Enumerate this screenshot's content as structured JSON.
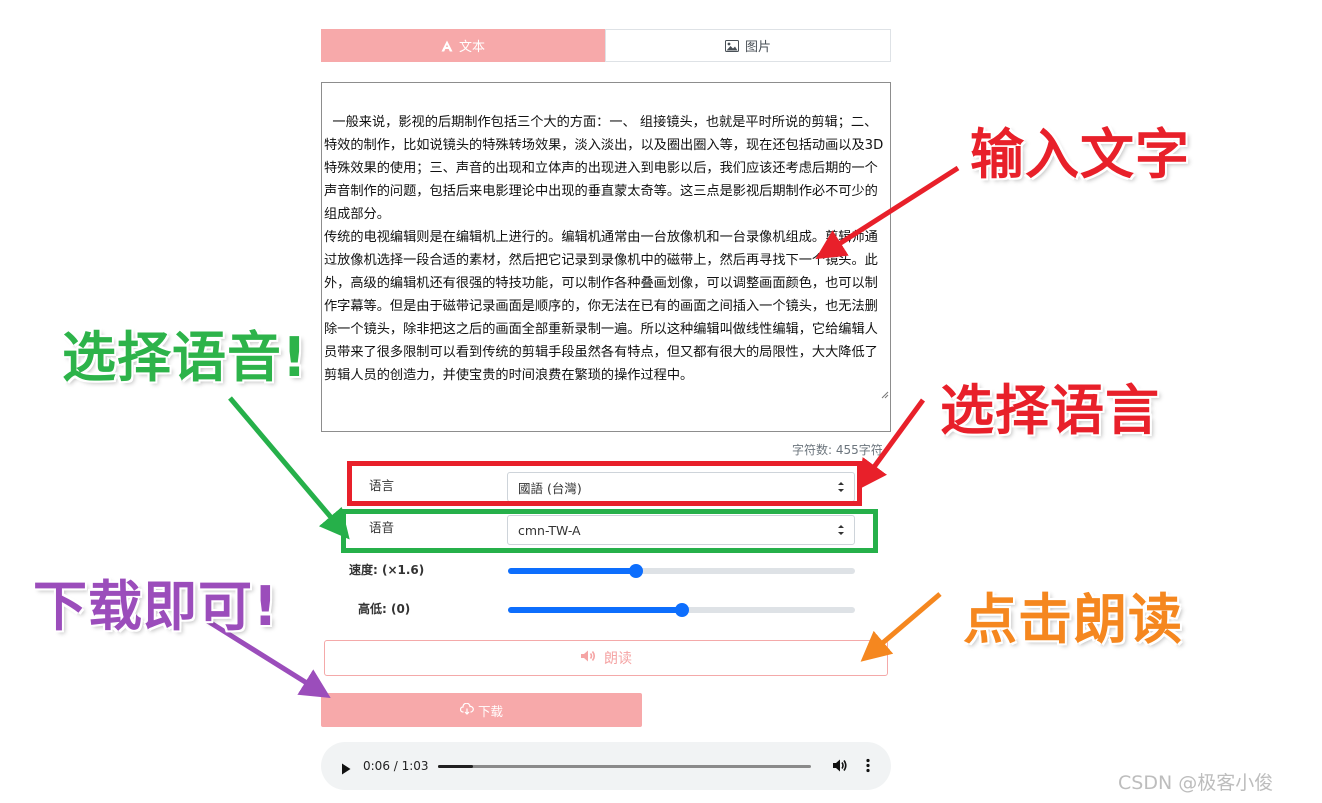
{
  "tabs": [
    {
      "label": "文本",
      "icon": "font-icon",
      "active": true
    },
    {
      "label": "图片",
      "icon": "image-icon",
      "active": false
    }
  ],
  "text_input": {
    "value": "一般来说，影视的后期制作包括三个大的方面：一、 组接镜头，也就是平时所说的剪辑；二、特效的制作，比如说镜头的特殊转场效果，淡入淡出，以及圈出圈入等，现在还包括动画以及3D特殊效果的使用；三、声音的出现和立体声的出现进入到电影以后，我们应该还考虑后期的一个声音制作的问题，包括后来电影理论中出现的垂直蒙太奇等。这三点是影视后期制作必不可少的组成部分。\n传统的电视编辑则是在编辑机上进行的。编辑机通常由一台放像机和一台录像机组成。剪辑师通过放像机选择一段合适的素材，然后把它记录到录像机中的磁带上，然后再寻找下一个镜头。此外，高级的编辑机还有很强的特技功能，可以制作各种叠画划像，可以调整画面颜色，也可以制作字幕等。但是由于磁带记录画面是顺序的，你无法在已有的画面之间插入一个镜头，也无法删除一个镜头，除非把这之后的画面全部重新录制一遍。所以这种编辑叫做线性编辑，它给编辑人员带来了很多限制可以看到传统的剪辑手段虽然各有特点，但又都有很大的局限性，大大降低了剪辑人员的创造力，并使宝贵的时间浪费在繁琐的操作过程中。",
    "char_count_label": "字符数:",
    "char_count_value": "455字符"
  },
  "form": {
    "language_label": "语言",
    "language_value": "國語 (台灣)",
    "voice_label": "语音",
    "voice_value": "cmn-TW-A",
    "speed_label": "速度: (×1.6)",
    "speed_fraction": 0.37,
    "pitch_label": "高低: (0)",
    "pitch_fraction": 0.5
  },
  "buttons": {
    "read_label": "朗读",
    "download_label": "下载"
  },
  "audio": {
    "time": "0:06 / 1:03",
    "progress_fraction": 0.095
  },
  "annotations": {
    "input_text": "输入文字",
    "choose_voice": "选择语音!",
    "choose_language": "选择语言",
    "download_done": "下载即可!",
    "click_read": "点击朗读"
  },
  "watermark": "CSDN @极客小俊",
  "colors": {
    "accent_pink": "#f7a9aa",
    "slider_blue": "#0d6efd",
    "annot_red": "#e8202a",
    "annot_green": "#26b04a",
    "annot_orange": "#f5871f",
    "annot_purple": "#9b4dbb"
  }
}
